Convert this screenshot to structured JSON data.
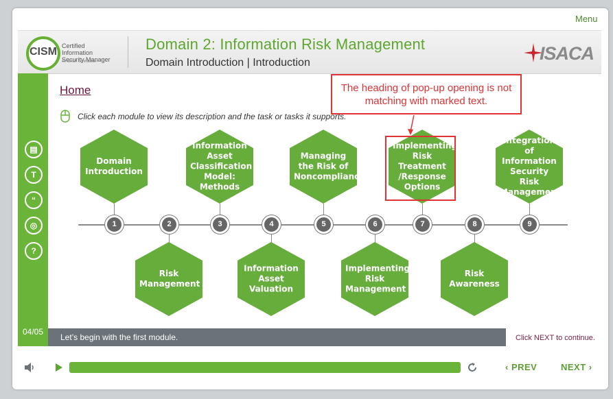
{
  "menu_label": "Menu",
  "header": {
    "logo": {
      "acronym": "CISM",
      "full_name": "Certified Information Security Manager",
      "tagline": "An ISACA Certification"
    },
    "title": "Domain 2: Information Risk Management",
    "subtitle": "Domain Introduction | Introduction",
    "brand": "ISACA"
  },
  "sidebar": {
    "icons": [
      "notes-icon",
      "transcript-icon",
      "quote-icon",
      "layers-icon",
      "help-icon"
    ],
    "icon_glyphs": [
      "▤",
      "T",
      "“",
      "◎",
      "?"
    ],
    "page_indicator": "04/05"
  },
  "home_link": "Home",
  "instruction": "Click each module to view its description and the task or tasks it supports.",
  "callout": "The heading of pop-up opening is not matching with marked text.",
  "modules": [
    {
      "number": "1",
      "title": "Domain Introduction"
    },
    {
      "number": "2",
      "title": "Risk Management"
    },
    {
      "number": "3",
      "title": "Information Asset Classification Model: Methods"
    },
    {
      "number": "4",
      "title": "Information Asset Valuation"
    },
    {
      "number": "5",
      "title": "Managing the Risk of Noncompliance"
    },
    {
      "number": "6",
      "title": "Implementing Risk Management"
    },
    {
      "number": "7",
      "title": "Implementing Risk Treatment /Response Options"
    },
    {
      "number": "8",
      "title": "Risk Awareness"
    },
    {
      "number": "9",
      "title": "Integration of Information Security Risk Management"
    }
  ],
  "status_text": "Let’s begin with the first module.",
  "continue_text": "Click NEXT to continue.",
  "controls": {
    "prev_label": "PREV",
    "next_label": "NEXT",
    "progress": 1.0
  },
  "colors": {
    "accent_green": "#66ad3c",
    "callout_red": "#e03333",
    "link_maroon": "#6b1540"
  }
}
